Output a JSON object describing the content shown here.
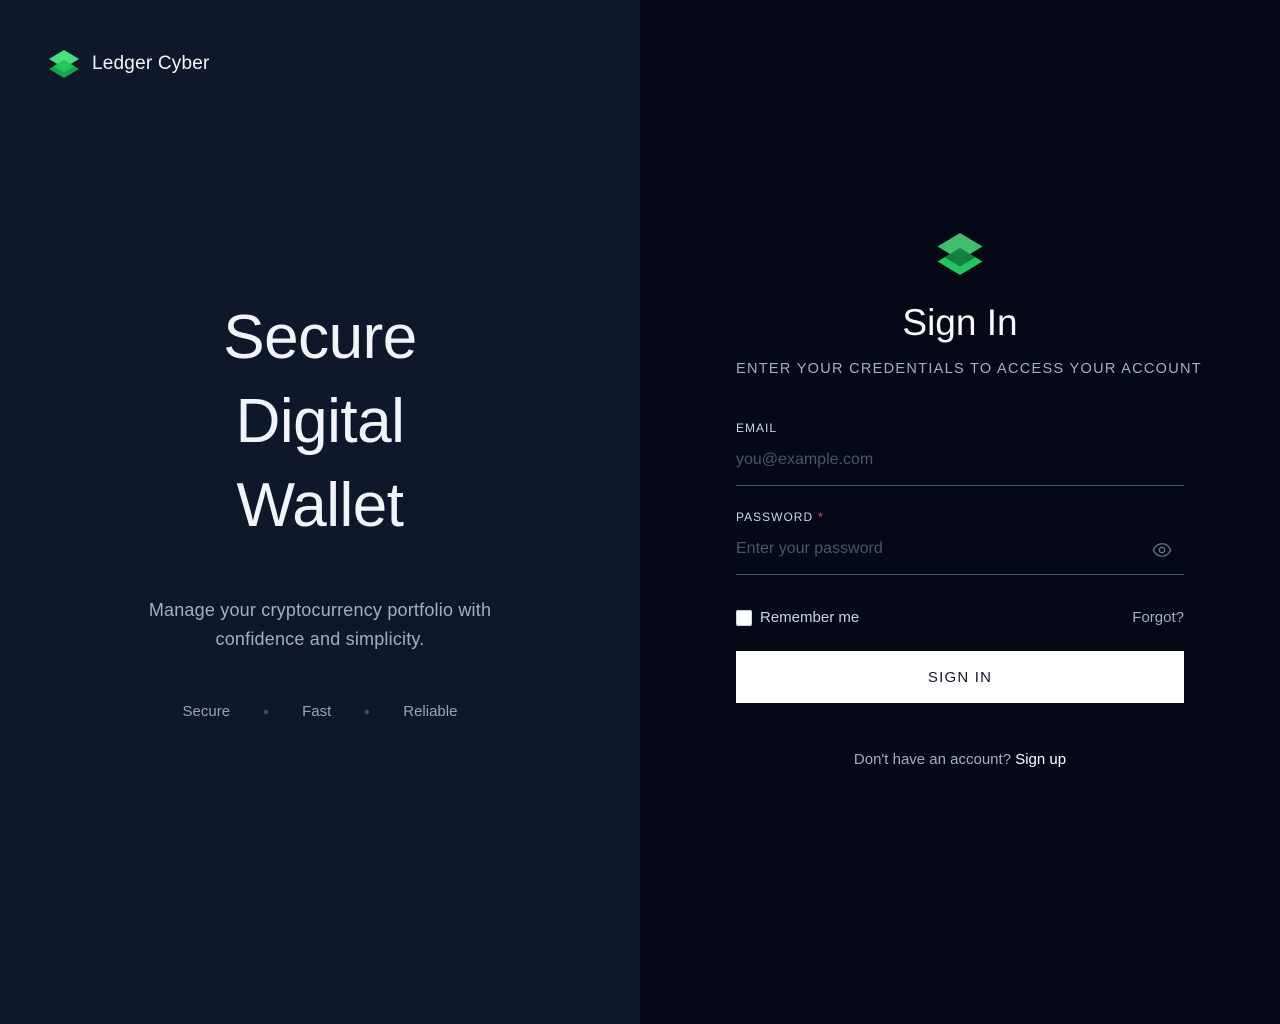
{
  "brand": {
    "name": "Ledger Cyber",
    "logo_icon": "layers-icon",
    "accent_color": "#22c55e"
  },
  "hero": {
    "lines": [
      "Secure",
      "Digital",
      "Wallet"
    ],
    "tagline_lines": [
      "Manage your cryptocurrency portfolio with",
      "confidence and simplicity."
    ],
    "features": [
      "Secure",
      "Fast",
      "Reliable"
    ]
  },
  "form": {
    "logo_icon": "layers-icon",
    "title": "Sign In",
    "subtitle": "ENTER YOUR CREDENTIALS TO ACCESS YOUR ACCOUNT",
    "email": {
      "label": "EMAIL",
      "placeholder": "you@example.com",
      "value": ""
    },
    "password": {
      "label": "PASSWORD",
      "required_mark": "*",
      "placeholder": "Enter your password",
      "value": "",
      "toggle_icon": "eye-icon"
    },
    "remember": {
      "label": "Remember me",
      "checked": false
    },
    "forgot_label": "Forgot?",
    "submit_label": "SIGN IN",
    "signup_prompt": "Don't have an account?",
    "signup_link": "Sign up"
  }
}
